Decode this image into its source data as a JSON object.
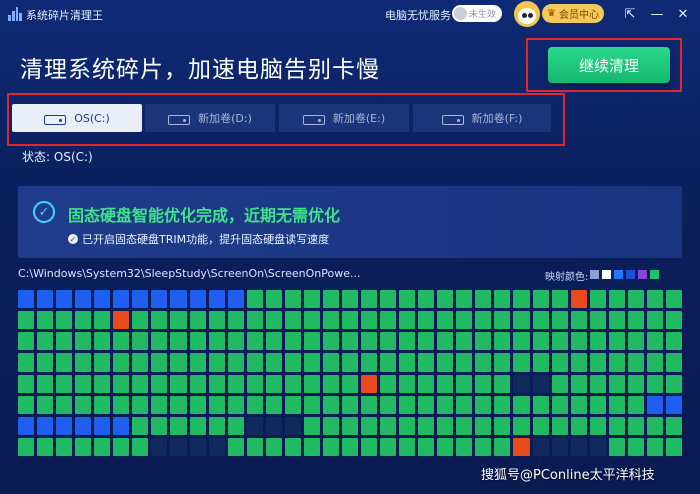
{
  "titlebar": {
    "app_title": "系统碎片清理王",
    "service_label": "电脑无忧服务",
    "service_toggle_text": "未生效",
    "vip_label": "会员中心",
    "vip_icon": "crown-icon"
  },
  "header": {
    "headline": "清理系统碎片，加速电脑告别卡慢",
    "continue_button": "继续清理"
  },
  "tabs": [
    {
      "label": "OS(C:)",
      "active": true
    },
    {
      "label": "新加卷(D:)",
      "active": false
    },
    {
      "label": "新加卷(E:)",
      "active": false
    },
    {
      "label": "新加卷(F:)",
      "active": false
    }
  ],
  "status": {
    "label": "状态:",
    "value": "OS(C:)"
  },
  "result_panel": {
    "title": "固态硬盘智能优化完成，近期无需优化",
    "subtitle": "已开启固态硬盘TRIM功能，提升固态硬盘读写速度"
  },
  "map": {
    "current_path": "C:\\Windows\\System32\\SleepStudy\\ScreenOn\\ScreenOnPowe...",
    "legend_label": "映射颜色:",
    "legend_colors": [
      "#8aa2d6",
      "#ffffff",
      "#2176ff",
      "#1d4fd8",
      "#8e44d6",
      "#1fc36a"
    ],
    "colors": {
      "G": "#1fba62",
      "B": "#1f5ff0",
      "R": "#e84a1c",
      "D": "#12295e"
    },
    "rows": [
      "BBBBBBBBBBBBGGGGGGGGGGGGGGGGGRGGGGG",
      "GGGGGRGGGGGGGGGGGGGGGGGGGGGGGGGGGGG",
      "GGGGGGGGGGGGGGGGGGGGGGGGGGGGGGGGGGG",
      "GGGGGGGGGGGGGGGGGGGGGGGGGGGGGGGGGGG",
      "GGGGGGGGGGGGGGGGGGRGGGGGGGDDGGGGGGG",
      "GGGGGGGGGGGGGGGGGGGGGGGGGGGGGGGGGBB",
      "BBBBBBGGGGGGDDDGGGGGGGGGGGGGGGGGGGG",
      "GGGGGGGDDDDGGGGGGGGGGGGGGGRDDDDGGGG"
    ]
  },
  "watermark": "搜狐号@PConline太平洋科技"
}
